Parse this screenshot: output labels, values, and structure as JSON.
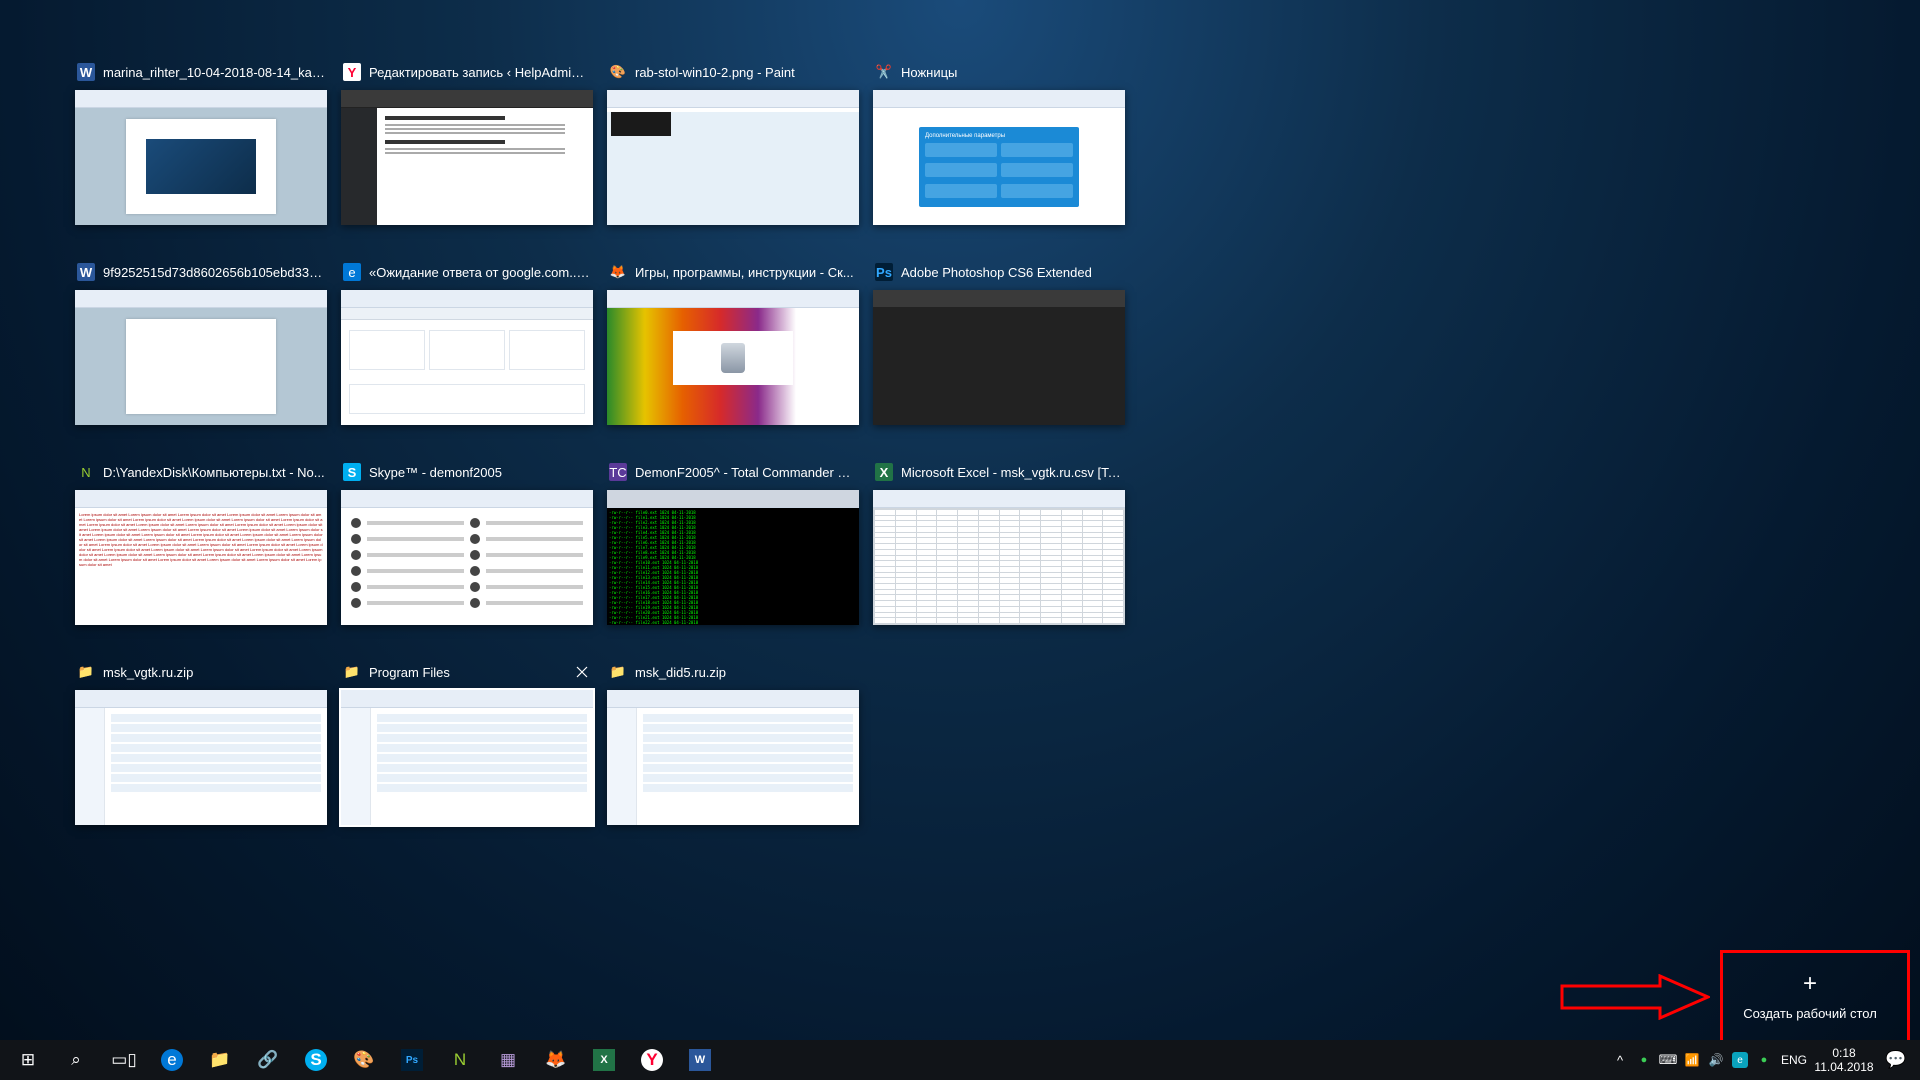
{
  "windows": [
    {
      "icon": "word-icon",
      "iconCls": "ic-word",
      "iconGlyph": "W",
      "title": "marina_rihter_10-04-2018-08-14_kak_...",
      "thumb": "word"
    },
    {
      "icon": "yandex-icon",
      "iconCls": "ic-yandex",
      "iconGlyph": "Y",
      "title": "Редактировать запись ‹ HelpAdmins....",
      "thumb": "yandex"
    },
    {
      "icon": "paint-icon",
      "iconCls": "ic-paint",
      "iconGlyph": "🎨",
      "title": "rab-stol-win10-2.png - Paint",
      "thumb": "paint"
    },
    {
      "icon": "scissors-icon",
      "iconCls": "ic-snip",
      "iconGlyph": "✂️",
      "title": "Ножницы",
      "thumb": "snip"
    },
    {
      "icon": "word-icon",
      "iconCls": "ic-word",
      "iconGlyph": "W",
      "title": "9f9252515d73d8602656b105ebd338c...",
      "thumb": "word2"
    },
    {
      "icon": "edge-icon",
      "iconCls": "ic-edge",
      "iconGlyph": "e",
      "title": "«Ожидание ответа от google.com...»...",
      "thumb": "edge"
    },
    {
      "icon": "firefox-icon",
      "iconCls": "ic-ff",
      "iconGlyph": "🦊",
      "title": "Игры, программы, инструкции - Ск...",
      "thumb": "ff"
    },
    {
      "icon": "photoshop-icon",
      "iconCls": "ic-ps",
      "iconGlyph": "Ps",
      "title": "Adobe Photoshop CS6 Extended",
      "thumb": "ps"
    },
    {
      "icon": "notepadpp-icon",
      "iconCls": "ic-npp",
      "iconGlyph": "N",
      "title": "D:\\YandexDisk\\Компьютеры.txt - No...",
      "thumb": "npp"
    },
    {
      "icon": "skype-icon",
      "iconCls": "ic-skype",
      "iconGlyph": "S",
      "title": "Skype™ - demonf2005",
      "thumb": "skype"
    },
    {
      "icon": "totalcmd-icon",
      "iconCls": "ic-tc",
      "iconGlyph": "TC",
      "title": "DemonF2005^ - Total Commander 8....",
      "thumb": "tc"
    },
    {
      "icon": "excel-icon",
      "iconCls": "ic-xl",
      "iconGlyph": "X",
      "title": "Microsoft Excel - msk_vgtk.ru.csv  [To...",
      "thumb": "excel"
    },
    {
      "icon": "folder-icon",
      "iconCls": "ic-folder",
      "iconGlyph": "📁",
      "title": "msk_vgtk.ru.zip",
      "thumb": "exp"
    },
    {
      "icon": "folder-icon",
      "iconCls": "ic-folder",
      "iconGlyph": "📁",
      "title": "Program Files",
      "thumb": "exp",
      "active": true
    },
    {
      "icon": "folder-icon",
      "iconCls": "ic-folder",
      "iconGlyph": "📁",
      "title": "msk_did5.ru.zip",
      "thumb": "exp"
    }
  ],
  "snip": {
    "heading": "Дополнительные параметры"
  },
  "newDesktop": {
    "label": "Создать рабочий стол"
  },
  "taskbar": {
    "buttons": [
      {
        "name": "start-button",
        "glyph": "⊞"
      },
      {
        "name": "search-button",
        "glyph": "⌕"
      },
      {
        "name": "task-view-button",
        "glyph": "▭▯"
      },
      {
        "name": "edge-button",
        "glyph": "e",
        "cls": "ic-edge",
        "style": "background:#0078d7;border-radius:50%;width:22px;height:22px;"
      },
      {
        "name": "explorer-button",
        "glyph": "📁"
      },
      {
        "name": "share-button",
        "glyph": "🔗"
      },
      {
        "name": "skype-button",
        "glyph": "S",
        "cls": "ic-skype",
        "style": "background:#00aff0;border-radius:50%;width:22px;height:22px;"
      },
      {
        "name": "paint-button",
        "glyph": "🎨"
      },
      {
        "name": "photoshop-button",
        "glyph": "Ps",
        "cls": "ic-ps",
        "style": "background:#001e36;width:22px;height:22px;font-size:10px;"
      },
      {
        "name": "notepadpp-button",
        "glyph": "N",
        "style": "color:#9acd32;"
      },
      {
        "name": "totalcmd-button",
        "glyph": "▦",
        "style": "color:#b79bd8;"
      },
      {
        "name": "firefox-button",
        "glyph": "🦊"
      },
      {
        "name": "excel-button",
        "glyph": "X",
        "cls": "ic-xl",
        "style": "background:#217346;width:22px;height:22px;font-size:11px;"
      },
      {
        "name": "yandex-button",
        "glyph": "Y",
        "cls": "ic-yandex",
        "style": "background:#fff;color:#f03;border-radius:50%;width:22px;height:22px;"
      },
      {
        "name": "word-button",
        "glyph": "W",
        "cls": "ic-word",
        "style": "background:#2b579a;width:22px;height:22px;font-size:11px;"
      }
    ],
    "tray": [
      {
        "name": "tray-chevron-icon",
        "glyph": "^"
      },
      {
        "name": "tray-yadisk-icon",
        "glyph": "●",
        "style": "color:#3bcd56;font-size:11px;"
      },
      {
        "name": "tray-keyboard-icon",
        "glyph": "⌨"
      },
      {
        "name": "tray-wifi-icon",
        "glyph": "📶",
        "style": "font-size:12px;"
      },
      {
        "name": "tray-volume-icon",
        "glyph": "🔊",
        "style": "font-size:12px;"
      },
      {
        "name": "tray-app1-icon",
        "glyph": "e",
        "style": "background:#0aa3bd;border-radius:3px;width:16px;height:16px;font-size:10px;"
      },
      {
        "name": "tray-app2-icon",
        "glyph": "●",
        "style": "color:#3bcd56;font-size:11px;"
      }
    ],
    "lang": "ENG",
    "time": "0:18",
    "date": "11.04.2018",
    "notifGlyph": "💬"
  }
}
